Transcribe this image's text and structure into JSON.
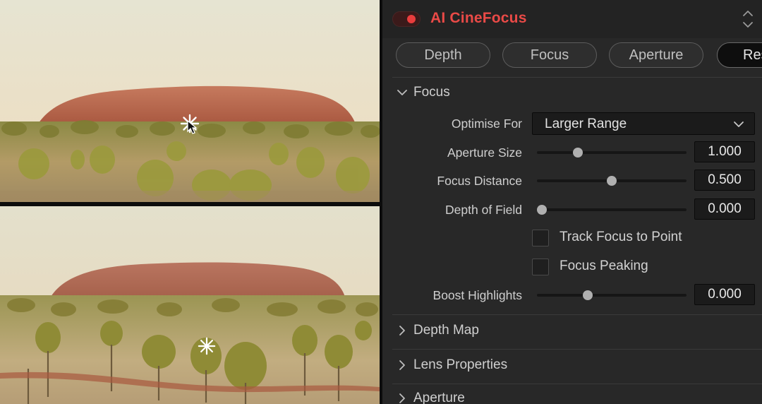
{
  "plugin": {
    "title": "AI CineFocus",
    "enabled": true,
    "accent_color": "#ea4a47"
  },
  "tabs": [
    {
      "label": "Depth",
      "active": false
    },
    {
      "label": "Focus",
      "active": false
    },
    {
      "label": "Aperture",
      "active": false
    },
    {
      "label": "Res",
      "active": true
    }
  ],
  "sections": {
    "focus": {
      "title": "Focus",
      "expanded": true,
      "optimise_for": {
        "label": "Optimise For",
        "value": "Larger Range"
      },
      "aperture_size": {
        "label": "Aperture Size",
        "value": "1.000",
        "position": 0.26
      },
      "focus_distance": {
        "label": "Focus Distance",
        "value": "0.500",
        "position": 0.5
      },
      "depth_of_field": {
        "label": "Depth of Field",
        "value": "0.000",
        "position": 0.0
      },
      "track_focus": {
        "label": "Track Focus to Point",
        "checked": false
      },
      "focus_peaking": {
        "label": "Focus Peaking",
        "checked": false
      },
      "boost_highlights": {
        "label": "Boost Highlights",
        "value": "0.000",
        "position": 0.33
      }
    },
    "depth_map": {
      "title": "Depth Map",
      "expanded": false
    },
    "lens_properties": {
      "title": "Lens Properties",
      "expanded": false
    },
    "aperture": {
      "title": "Aperture",
      "expanded": false
    }
  },
  "icons": {
    "focus_point": "asterisk-icon",
    "cursor": "mouse-pointer-icon",
    "section_expanded": "chevron-down-icon",
    "section_collapsed": "chevron-right-icon",
    "dropdown": "chevron-down-icon",
    "panel_scroll": "up-down-icon"
  }
}
